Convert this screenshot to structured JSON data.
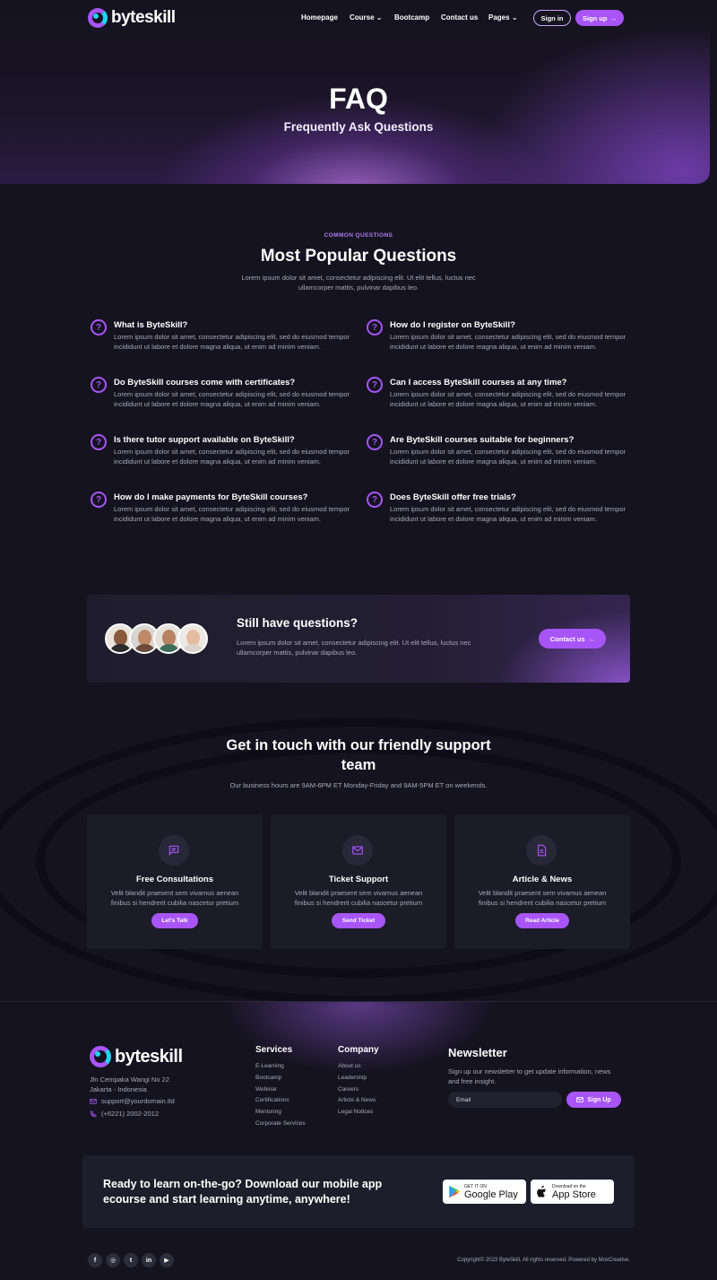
{
  "brand": {
    "name": "byteskill"
  },
  "nav": {
    "links": [
      "Homepage",
      "Course",
      "Bootcamp",
      "Contact us",
      "Pages"
    ],
    "sign_in": "Sign in",
    "sign_up": "Sign up"
  },
  "hero": {
    "title": "FAQ",
    "subtitle": "Frequently Ask Questions"
  },
  "faq": {
    "eyebrow": "COMMON QUESTIONS",
    "title": "Most Popular Questions",
    "description": "Lorem ipsum dolor sit amet, consectetur adipiscing elit. Ut elit tellus, luctus nec ullamcorper mattis, pulvinar dapibus leo.",
    "items": [
      {
        "question": "What is ByteSkill?",
        "answer": "Lorem ipsum dolor sit amet, consectetur adipiscing elit, sed do eiusmod tempor incididunt ut labore et dolore magna aliqua, ut enim ad minim veniam."
      },
      {
        "question": "How do I register on ByteSkill?",
        "answer": "Lorem ipsum dolor sit amet, consectetur adipiscing elit, sed do eiusmod tempor incididunt ut labore et dolore magna aliqua, ut enim ad minim veniam."
      },
      {
        "question": "Do ByteSkill courses come with certificates?",
        "answer": "Lorem ipsum dolor sit amet, consectetur adipiscing elit, sed do eiusmod tempor incididunt ut labore et dolore magna aliqua, ut enim ad minim veniam."
      },
      {
        "question": "Can I access ByteSkill courses at any time?",
        "answer": "Lorem ipsum dolor sit amet, consectetur adipiscing elit, sed do eiusmod tempor incididunt ut labore et dolore magna aliqua, ut enim ad minim veniam."
      },
      {
        "question": "Is there tutor support available on ByteSkill?",
        "answer": "Lorem ipsum dolor sit amet, consectetur adipiscing elit, sed do eiusmod tempor incididunt ut labore et dolore magna aliqua, ut enim ad minim veniam."
      },
      {
        "question": "Are ByteSkill courses suitable for beginners?",
        "answer": "Lorem ipsum dolor sit amet, consectetur adipiscing elit, sed do eiusmod tempor incididunt ut labore et dolore magna aliqua, ut enim ad minim veniam."
      },
      {
        "question": "How do I make payments for ByteSkill courses?",
        "answer": "Lorem ipsum dolor sit amet, consectetur adipiscing elit, sed do eiusmod tempor incididunt ut labore et dolore magna aliqua, ut enim ad minim veniam."
      },
      {
        "question": "Does ByteSkill offer free trials?",
        "answer": "Lorem ipsum dolor sit amet, consectetur adipiscing elit, sed do eiusmod tempor incididunt ut labore et dolore magna aliqua, ut enim ad minim veniam."
      }
    ]
  },
  "still": {
    "title": "Still have questions?",
    "description": "Lorem ipsum dolor sit amet, consectetur adipiscing elit. Ut elit tellus, luctus nec ullamcorper mattis, pulvinar dapibus leo.",
    "button": "Contact us"
  },
  "touch": {
    "title": "Get in touch with our friendly support team",
    "description": "Our business hours are 9AM-6PM ET Monday-Friday and 9AM-5PM ET on weekends.",
    "cards": [
      {
        "icon": "chat-icon",
        "title": "Free Consultations",
        "description": "Velit blandit praesent sem vivamus aenean finibus si hendrerit cubilia nascetur pretium",
        "button": "Let's Talk"
      },
      {
        "icon": "ticket-icon",
        "title": "Ticket Support",
        "description": "Velit blandit praesent sem vivamus aenean finibus si hendrerit cubilia nascetur pretium",
        "button": "Send Ticket"
      },
      {
        "icon": "document-icon",
        "title": "Article & News",
        "description": "Velit blandit praesent sem vivamus aenean finibus si hendrerit cubilia nascetur pretium",
        "button": "Read Article"
      }
    ]
  },
  "footer": {
    "address_line1": "Jln Cempaka Wangi No 22",
    "address_line2": "Jakarta - Indonesia",
    "email": "support@yourdomain.tld",
    "phone": "(+6221) 2002-2012",
    "services": {
      "title": "Services",
      "items": [
        "E-Learning",
        "Bootcamp",
        "Webinar",
        "Certifications",
        "Mentoring",
        "Corporate Services"
      ]
    },
    "company": {
      "title": "Company",
      "items": [
        "About us",
        "Leadership",
        "Careers",
        "Article & News",
        "Legal Notices"
      ]
    },
    "newsletter": {
      "title": "Newsletter",
      "description": "Sign up our newsletter to get update information, news and free insight.",
      "placeholder": "Email",
      "button": "Sign Up"
    },
    "app": {
      "text": "Ready to learn on-the-go? Download our mobile app ecourse and start learning anytime, anywhere!",
      "google_small": "GET IT ON",
      "google_big": "Google Play",
      "apple_small": "Download on the",
      "apple_big": "App Store"
    },
    "socials": [
      "facebook-icon",
      "instagram-icon",
      "twitter-icon",
      "linkedin-icon",
      "youtube-icon"
    ],
    "copyright": "Copyright© 2023 ByteSkill, All rights reserved. Powered by MoxCreative."
  },
  "colors": {
    "accent": "#a855f7",
    "cyan": "#22d3ee",
    "background": "#14131f",
    "card": "#1c1b28"
  }
}
